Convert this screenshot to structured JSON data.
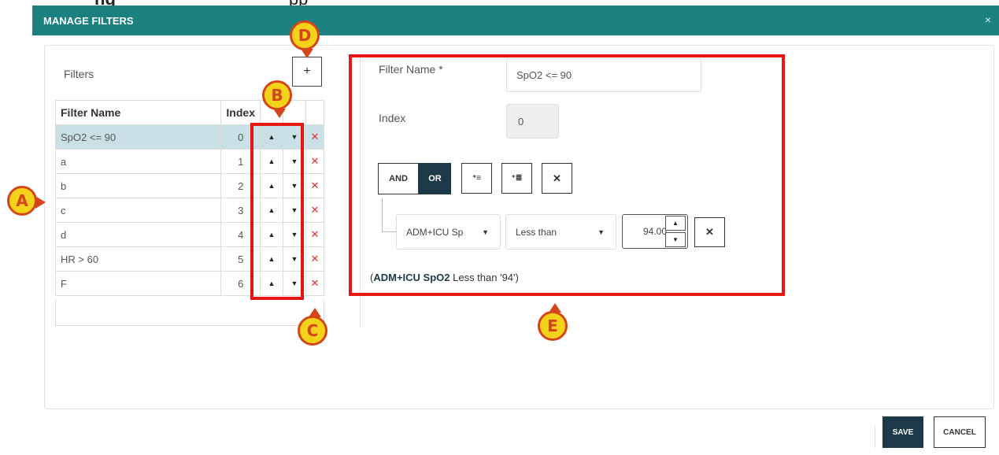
{
  "window": {
    "title": "MANAGE FILTERS",
    "close_label": "×"
  },
  "cutoff_text": {
    "bold": "ng",
    "rest": "pp"
  },
  "filters_panel": {
    "label": "Filters",
    "add_label": "+",
    "columns": [
      "Filter Name",
      "Index"
    ],
    "up_symbol": "▲",
    "down_symbol": "▼",
    "delete_symbol": "✕",
    "rows": [
      {
        "name": "SpO2 <= 90",
        "index": "0",
        "selected": true
      },
      {
        "name": "a",
        "index": "1"
      },
      {
        "name": "b",
        "index": "2"
      },
      {
        "name": "c",
        "index": "3"
      },
      {
        "name": "d",
        "index": "4"
      },
      {
        "name": "HR > 60",
        "index": "5"
      },
      {
        "name": "F",
        "index": "6"
      }
    ]
  },
  "editor": {
    "filter_name_label": "Filter Name *",
    "filter_name_value": "SpO2 <= 90",
    "index_label": "Index",
    "index_value": "0",
    "and_label": "AND",
    "or_label": "OR",
    "add_condition_icon": "⁺≡",
    "add_group_icon": "⁺≣",
    "remove_label": "✕",
    "condition": {
      "field_value": "ADM+ICU Sp",
      "operator_value": "Less than",
      "number_value": "94.00",
      "caret": "▼",
      "spin_up": "▲",
      "spin_down": "▼",
      "remove_label": "✕"
    },
    "summary": {
      "open": "(",
      "bold": "ADM+ICU SpO2",
      "rest": " Less than '94')"
    }
  },
  "footer": {
    "save_label": "SAVE",
    "cancel_label": "CANCEL"
  },
  "callouts": {
    "a": "A",
    "b": "B",
    "c": "C",
    "d": "D",
    "e": "E"
  },
  "colors": {
    "header": "#1b8080",
    "callout_red": "#e41616",
    "marker_yellow": "#f5d21a",
    "dark_button": "#1d3a48",
    "selected_row": "#c9e1e6"
  }
}
